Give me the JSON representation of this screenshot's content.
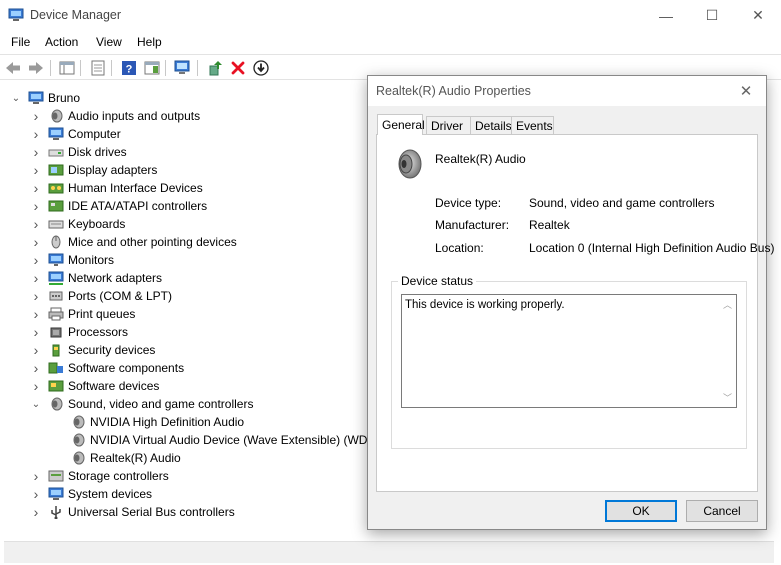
{
  "window": {
    "title": "Device Manager",
    "minimize": "—",
    "maximize": "☐",
    "close": "✕"
  },
  "menu": [
    "File",
    "Action",
    "View",
    "Help"
  ],
  "tree": {
    "root": "Bruno",
    "items": [
      {
        "label": "Audio inputs and outputs",
        "icon": "speaker-icon",
        "expanded": false
      },
      {
        "label": "Computer",
        "icon": "computer-icon",
        "expanded": false
      },
      {
        "label": "Disk drives",
        "icon": "disk-drive-icon",
        "expanded": false
      },
      {
        "label": "Display adapters",
        "icon": "display-adapter-icon",
        "expanded": false
      },
      {
        "label": "Human Interface Devices",
        "icon": "hid-icon",
        "expanded": false
      },
      {
        "label": "IDE ATA/ATAPI controllers",
        "icon": "ide-controller-icon",
        "expanded": false
      },
      {
        "label": "Keyboards",
        "icon": "keyboard-icon",
        "expanded": false
      },
      {
        "label": "Mice and other pointing devices",
        "icon": "mouse-icon",
        "expanded": false
      },
      {
        "label": "Monitors",
        "icon": "monitor-icon",
        "expanded": false
      },
      {
        "label": "Network adapters",
        "icon": "network-adapter-icon",
        "expanded": false
      },
      {
        "label": "Ports (COM & LPT)",
        "icon": "port-icon",
        "expanded": false
      },
      {
        "label": "Print queues",
        "icon": "printer-icon",
        "expanded": false
      },
      {
        "label": "Processors",
        "icon": "processor-icon",
        "expanded": false
      },
      {
        "label": "Security devices",
        "icon": "security-device-icon",
        "expanded": false
      },
      {
        "label": "Software components",
        "icon": "software-component-icon",
        "expanded": false
      },
      {
        "label": "Software devices",
        "icon": "software-device-icon",
        "expanded": false
      },
      {
        "label": "Sound, video and game controllers",
        "icon": "speaker-icon",
        "expanded": true
      },
      {
        "label": "NVIDIA High Definition Audio",
        "icon": "speaker-icon",
        "child": true
      },
      {
        "label": "NVIDIA Virtual Audio Device (Wave Extensible) (WDM)",
        "icon": "speaker-icon",
        "child": true
      },
      {
        "label": "Realtek(R) Audio",
        "icon": "speaker-icon",
        "child": true
      },
      {
        "label": "Storage controllers",
        "icon": "storage-controller-icon",
        "expanded": false
      },
      {
        "label": "System devices",
        "icon": "system-device-icon",
        "expanded": false
      },
      {
        "label": "Universal Serial Bus controllers",
        "icon": "usb-icon",
        "expanded": false
      }
    ]
  },
  "dialog": {
    "title": "Realtek(R) Audio Properties",
    "close": "✕",
    "tabs": [
      "General",
      "Driver",
      "Details",
      "Events"
    ],
    "active_tab": "General",
    "device_name": "Realtek(R) Audio",
    "properties": [
      {
        "label": "Device type:",
        "value": "Sound, video and game controllers"
      },
      {
        "label": "Manufacturer:",
        "value": "Realtek"
      },
      {
        "label": "Location:",
        "value": "Location 0 (Internal High Definition Audio Bus)"
      }
    ],
    "status_group": "Device status",
    "status_text": "This device is working properly.",
    "ok": "OK",
    "cancel": "Cancel"
  },
  "colors": {
    "accent": "#0078d7",
    "delete_red": "#e81123",
    "help_blue": "#2b57b5"
  }
}
